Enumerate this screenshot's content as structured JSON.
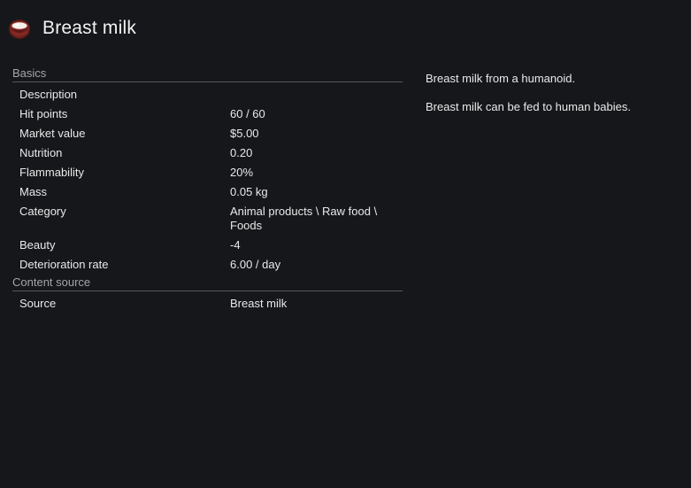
{
  "title": "Breast milk",
  "icon": "milk-bowl-icon",
  "sections": [
    {
      "header": "Basics",
      "rows": [
        {
          "label": "Description",
          "value": ""
        },
        {
          "label": "Hit points",
          "value": "60 / 60"
        },
        {
          "label": "Market value",
          "value": "$5.00"
        },
        {
          "label": "Nutrition",
          "value": "0.20"
        },
        {
          "label": "Flammability",
          "value": "20%"
        },
        {
          "label": "Mass",
          "value": "0.05 kg"
        },
        {
          "label": "Category",
          "value": "Animal products \\ Raw food \\ Foods"
        },
        {
          "label": "Beauty",
          "value": "-4"
        },
        {
          "label": "Deterioration rate",
          "value": "6.00 / day"
        }
      ]
    },
    {
      "header": "Content source",
      "rows": [
        {
          "label": "Source",
          "value": "Breast milk"
        }
      ]
    }
  ],
  "description": {
    "line1": "Breast milk from a humanoid.",
    "line2": "Breast milk can be fed to human babies."
  },
  "colors": {
    "background": "#15171b",
    "section_header": "#a5a5a5",
    "divider": "#55585e",
    "text": "#e9e9e9"
  }
}
